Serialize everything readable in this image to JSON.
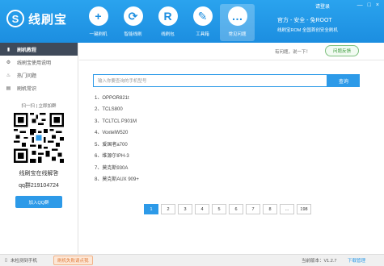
{
  "app": {
    "name": "线刷宝",
    "logo_letter": "S"
  },
  "header": {
    "login": "请登录",
    "win_controls": [
      "—",
      "□",
      "×"
    ],
    "right_line1": "官方 - 安全 - 免ROOT",
    "right_line2": "线刷宝ROM 全国首创安全刷机"
  },
  "nav": [
    {
      "label": "一键刷机",
      "icon": "plus-icon",
      "glyph": "+"
    },
    {
      "label": "智能线刷",
      "icon": "refresh-icon",
      "glyph": "⟳"
    },
    {
      "label": "线刷包",
      "icon": "rom-package-icon",
      "glyph": "R"
    },
    {
      "label": "工具箱",
      "icon": "wrench-icon",
      "glyph": "✎"
    },
    {
      "label": "常见问题",
      "icon": "chat-icon",
      "glyph": "…"
    }
  ],
  "sidebar": {
    "items": [
      {
        "label": "刷机教程",
        "icon": "book-icon",
        "glyph": "▮",
        "active": true
      },
      {
        "label": "线刷宝使用说明",
        "icon": "gear-icon",
        "glyph": "⚙",
        "active": false
      },
      {
        "label": "热门问题",
        "icon": "fire-icon",
        "glyph": "♨",
        "active": false
      },
      {
        "label": "刷机常识",
        "icon": "document-icon",
        "glyph": "▤",
        "active": false
      }
    ],
    "qr_title": "扫一扫 | 立即加群",
    "qq_label": "线刷宝在线解答",
    "qq_number": "qq群219104724",
    "qq_button": "加入QQ群"
  },
  "main": {
    "help_text": "有问题，说一下！",
    "feedback_button": "问题反馈",
    "search": {
      "placeholder": "输入你要查询的手机型号",
      "button": "查询"
    },
    "list": [
      "1、OPPOR821t",
      "2、TCLS800",
      "3、TCLTCL P301M",
      "4、VoxtelW520",
      "5、爱国者a700",
      "6、维源尔IPH-3",
      "7、莫克斯930A",
      "8、莫克斯AUX 909+"
    ],
    "pager": [
      "1",
      "2",
      "3",
      "4",
      "5",
      "6",
      "7",
      "8",
      "...",
      "198"
    ],
    "active_page": "1"
  },
  "status": {
    "device": "未检测到手机",
    "warning": "刷机失败请点我",
    "version": "当前版本：V1.2.7",
    "download": "下载管理"
  },
  "colors": {
    "accent": "#2d9ae8",
    "header": "#1c8ee0",
    "sidebar_active": "#3f4a5a"
  }
}
